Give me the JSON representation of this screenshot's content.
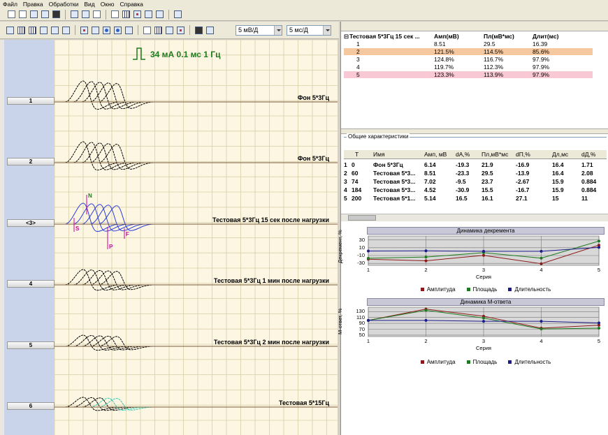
{
  "menu": [
    "Файл",
    "Правка",
    "Обработки",
    "Вид",
    "Окно",
    "Справка"
  ],
  "toolbar": {
    "sensitivity": "5 мВ/Д",
    "sweep": "5 мс/Д"
  },
  "stimulus_label": "34 мА  0.1 мс 1 Гц",
  "channels": [
    {
      "button": "1",
      "label": "Фон 5*3Гц"
    },
    {
      "button": "2",
      "label": "Фон 5*3Гц"
    },
    {
      "button": "<3>",
      "label": "Тестовая 5*3Гц 15 сек после нагрузки"
    },
    {
      "button": "4",
      "label": "Тестовая 5*3Гц 1 мин после нагрузки"
    },
    {
      "button": "5",
      "label": "Тестовая 5*3Гц 2 мин после нагрузки"
    },
    {
      "button": "6",
      "label": "Тестовая 5*15Гц"
    }
  ],
  "markers": {
    "n": "N",
    "s": "S",
    "f": "F",
    "p": "P"
  },
  "table1": {
    "title": "Тестовая 5*3Гц 15 сек ...",
    "headers": [
      "Амп(мВ)",
      "Пл(мВ*мс)",
      "Длит(мс)"
    ],
    "rows": [
      {
        "n": "1",
        "amp": "8.51",
        "area": "29.5",
        "dur": "16.39",
        "hl": ""
      },
      {
        "n": "2",
        "amp": "121.5%",
        "area": "114.5%",
        "dur": "85.6%",
        "hl": "orange"
      },
      {
        "n": "3",
        "amp": "124.8%",
        "area": "116.7%",
        "dur": "97.9%",
        "hl": ""
      },
      {
        "n": "4",
        "amp": "119.7%",
        "area": "112.3%",
        "dur": "97.9%",
        "hl": ""
      },
      {
        "n": "5",
        "amp": "123.3%",
        "area": "113.9%",
        "dur": "97.9%",
        "hl": "pink"
      }
    ]
  },
  "group_title": "Общие характеристики",
  "table2": {
    "headers": [
      "T",
      "Имя",
      "Амп, мВ",
      "dA,%",
      "Пл,мВ*мс",
      "dП,%",
      "Дл,мс",
      "dД,%"
    ],
    "rows": [
      [
        "1",
        "0",
        "Фон 5*3Гц",
        "6.14",
        "-19.3",
        "21.9",
        "-16.9",
        "16.4",
        "1.71"
      ],
      [
        "2",
        "60",
        "Тестовая 5*3...",
        "8.51",
        "-23.3",
        "29.5",
        "-13.9",
        "16.4",
        "2.08"
      ],
      [
        "3",
        "74",
        "Тестовая 5*3...",
        "7.02",
        "-9.5",
        "23.7",
        "-2.67",
        "15.9",
        "0.884"
      ],
      [
        "4",
        "184",
        "Тестовая 5*3...",
        "4.52",
        "-30.9",
        "15.5",
        "-16.7",
        "15.9",
        "0.884"
      ],
      [
        "5",
        "200",
        "Тестовая 5*1...",
        "5.14",
        "16.5",
        "16.1",
        "27.1",
        "15",
        "11"
      ]
    ]
  },
  "legend": {
    "amp": "Амплитуда",
    "area": "Площадь",
    "dur": "Длительность"
  },
  "colors": {
    "amp": "#8b1a1a",
    "area": "#1e7a1e",
    "dur": "#1a1a8b"
  },
  "chart_data": [
    {
      "type": "line",
      "title": "Динамика декремента",
      "xlabel": "Серия",
      "ylabel": "Декремент, %",
      "x": [
        1,
        2,
        3,
        4,
        5
      ],
      "yticks": [
        30,
        10,
        -10,
        -30
      ],
      "ylim": [
        -35,
        40
      ],
      "series": [
        {
          "name": "Амплитуда",
          "values": [
            -19.3,
            -23.3,
            -9.5,
            -30.9,
            16.5
          ]
        },
        {
          "name": "Площадь",
          "values": [
            -16.9,
            -13.9,
            -2.67,
            -16.7,
            27.1
          ]
        },
        {
          "name": "Длительность",
          "values": [
            1.71,
            2.08,
            0.884,
            0.884,
            11
          ]
        }
      ]
    },
    {
      "type": "line",
      "title": "Динамика М-ответа",
      "xlabel": "Серия",
      "ylabel": "М-ответ, %",
      "x": [
        1,
        2,
        3,
        4,
        5
      ],
      "yticks": [
        130,
        110,
        90,
        70,
        50
      ],
      "ylim": [
        45,
        145
      ],
      "series": [
        {
          "name": "Амплитуда",
          "values": [
            100,
            138.6,
            114.3,
            73.6,
            83.7
          ]
        },
        {
          "name": "Площадь",
          "values": [
            100,
            134.7,
            108.2,
            70.8,
            73.5
          ]
        },
        {
          "name": "Длительность",
          "values": [
            100,
            100,
            97,
            97,
            91.5
          ]
        }
      ]
    }
  ]
}
